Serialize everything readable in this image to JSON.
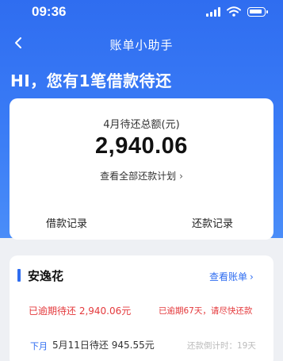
{
  "status_bar": {
    "time": "09:36"
  },
  "nav": {
    "title": "账单小助手",
    "back_icon": "chevron-left-icon"
  },
  "greeting": "HI，您有1笔借款待还",
  "summary": {
    "label": "4月待还总额(元)",
    "amount": "2,940.06",
    "view_plan": "查看全部还款计划",
    "borrow_records": "借款记录",
    "repay_records": "还款记录"
  },
  "loan": {
    "name": "安逸花",
    "view_bill": "查看账单",
    "overdue_text": "已逾期待还 2,940.06元",
    "overdue_tip": "已逾期67天，请尽快还款",
    "next_tag": "下月",
    "next_text": "5月11日待还  945.55元",
    "countdown": "还款倒计时：19天"
  },
  "colors": {
    "brand_blue": "#2f6df0",
    "overdue_red": "#e4393c",
    "page_bg": "#eef0f4"
  }
}
